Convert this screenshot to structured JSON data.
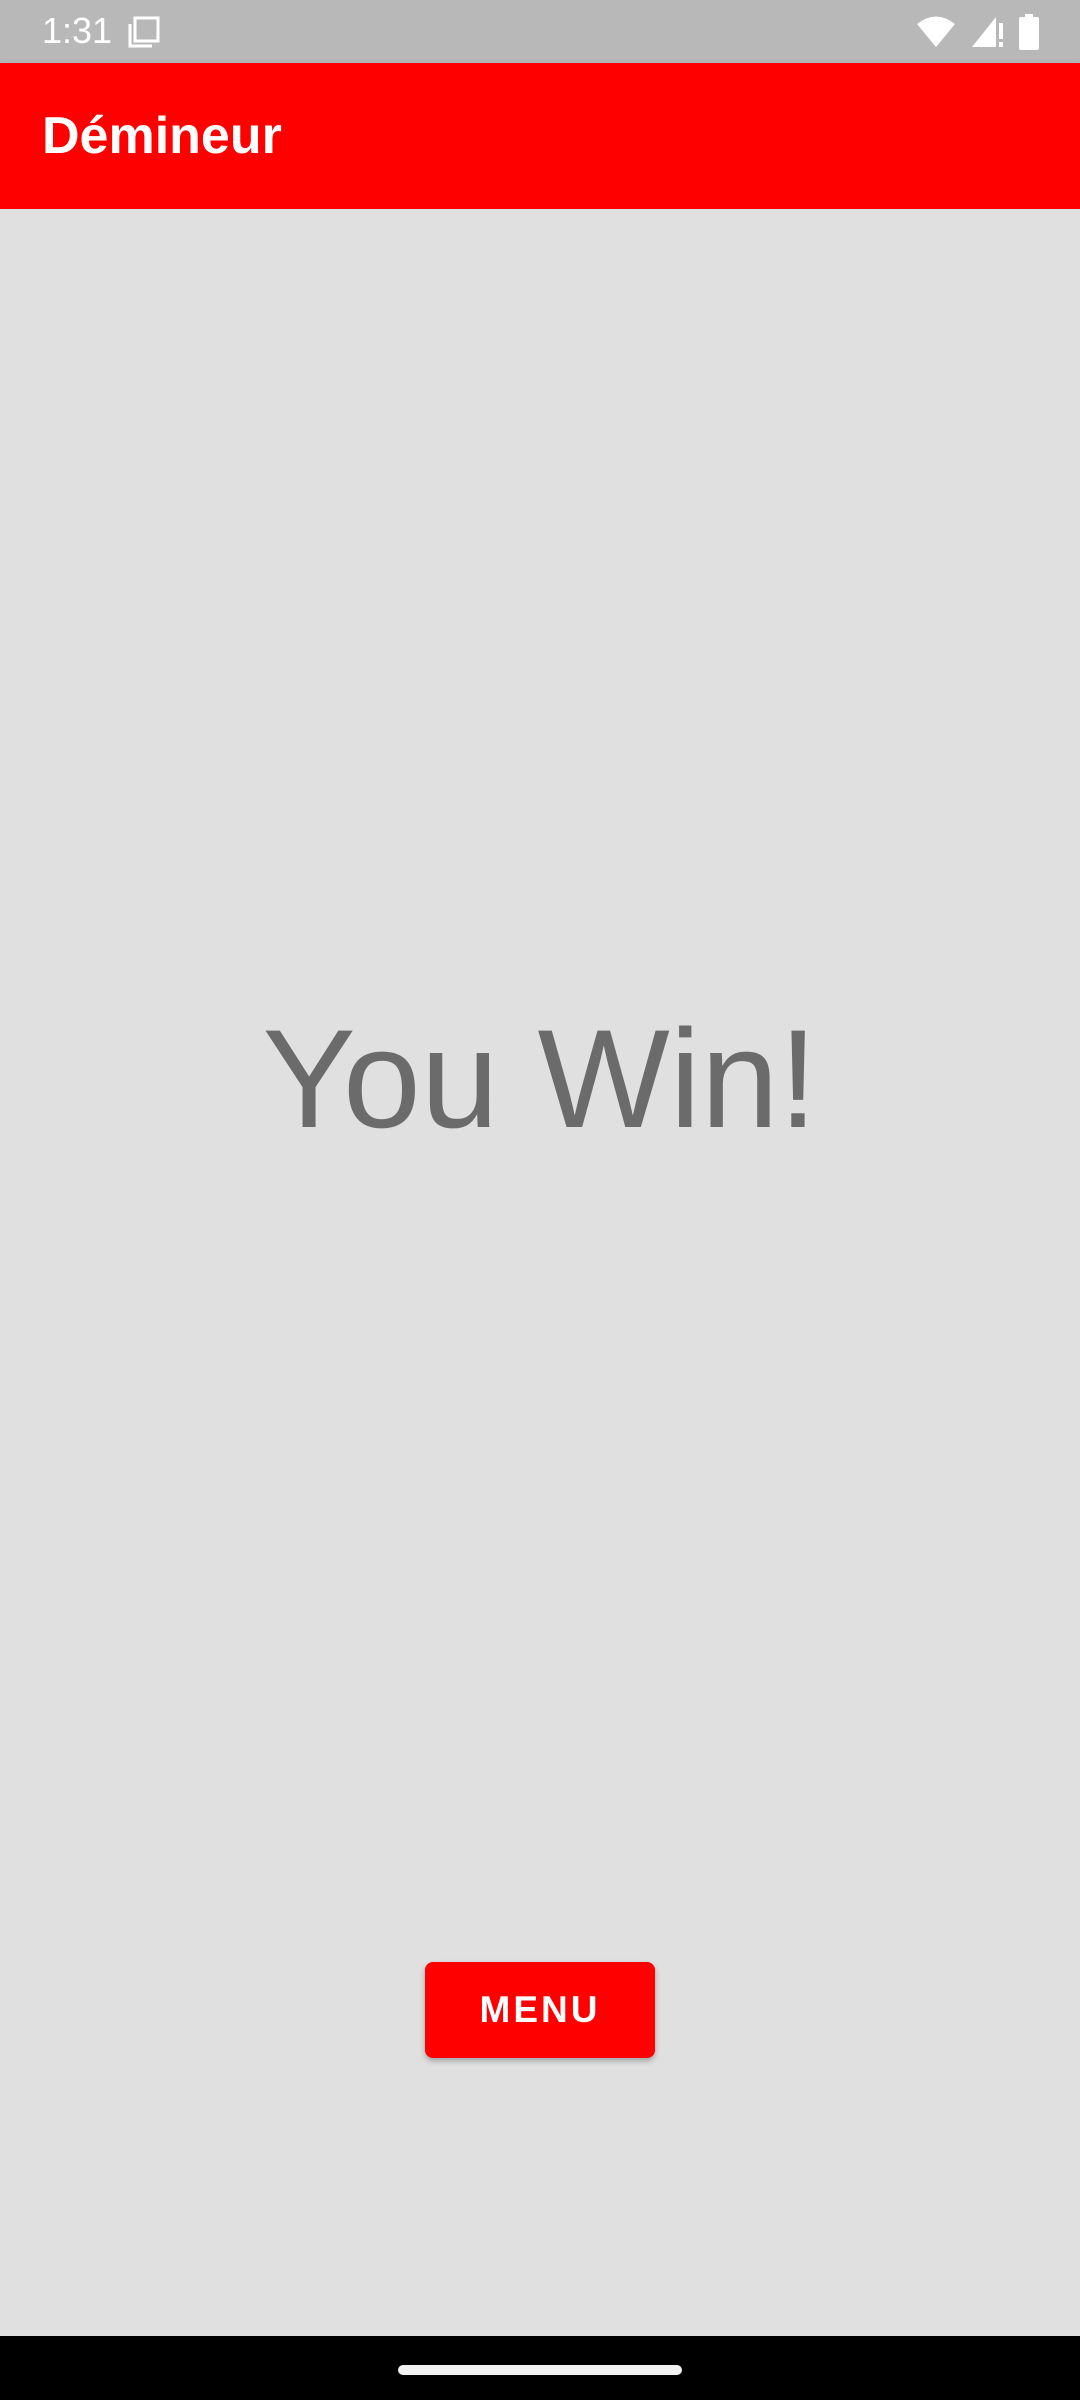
{
  "status_bar": {
    "time": "1:31",
    "left_icon": "screenshot-icon",
    "right_icons": [
      "wifi-icon",
      "signal-icon",
      "battery-icon"
    ]
  },
  "app_bar": {
    "title": "Démineur",
    "color": "#ff0000"
  },
  "main": {
    "result_text": "You Win!",
    "menu_button_label": "MENU"
  },
  "nav_bar": {
    "handle": "home-handle"
  }
}
